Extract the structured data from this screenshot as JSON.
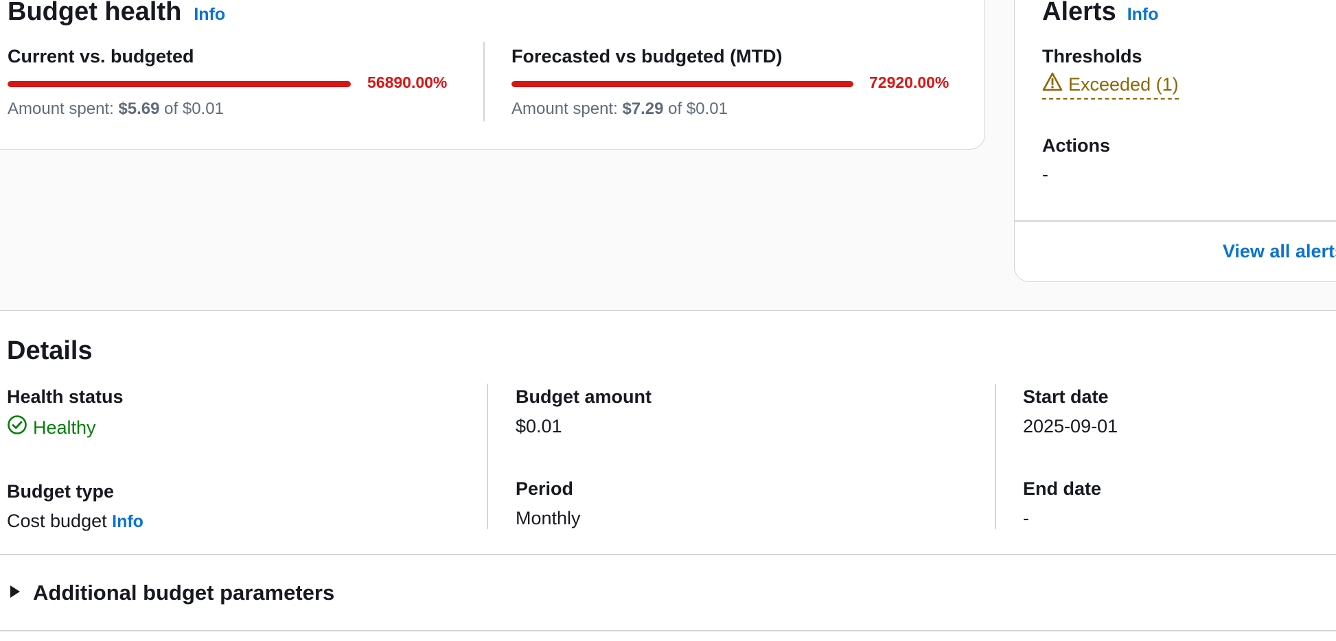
{
  "budget_health": {
    "title": "Budget health",
    "info_label": "Info",
    "current": {
      "label": "Current vs. budgeted",
      "percent_text": "56890.00%",
      "progress_fraction": 1.0,
      "sub_prefix": "Amount spent: ",
      "spent": "$5.69",
      "sub_mid": " of ",
      "budgeted": "$0.01"
    },
    "forecast": {
      "label": "Forecasted vs budgeted (MTD)",
      "percent_text": "72920.00%",
      "progress_fraction": 1.0,
      "sub_prefix": "Amount spent: ",
      "spent": "$7.29",
      "sub_mid": " of ",
      "budgeted": "$0.01"
    },
    "bar_color": "#d91515"
  },
  "alerts": {
    "title": "Alerts",
    "info_label": "Info",
    "thresholds_label": "Thresholds",
    "thresholds_value": "Exceeded (1)",
    "thresholds_icon": "warning-icon",
    "actions_label": "Actions",
    "actions_value": "-",
    "view_all_label": "View all alerts",
    "warning_color": "#8d6605"
  },
  "details": {
    "title": "Details",
    "health_status_label": "Health status",
    "health_status_value": "Healthy",
    "health_status_icon": "check-circle-icon",
    "budget_type_label": "Budget type",
    "budget_type_value": "Cost budget",
    "budget_type_info": "Info",
    "budget_amount_label": "Budget amount",
    "budget_amount_value": "$0.01",
    "period_label": "Period",
    "period_value": "Monthly",
    "start_date_label": "Start date",
    "start_date_value": "2025-09-01",
    "end_date_label": "End date",
    "end_date_value": "-",
    "additional_label": "Additional budget parameters",
    "healthy_color": "#037f0c",
    "link_color": "#0972d3"
  }
}
